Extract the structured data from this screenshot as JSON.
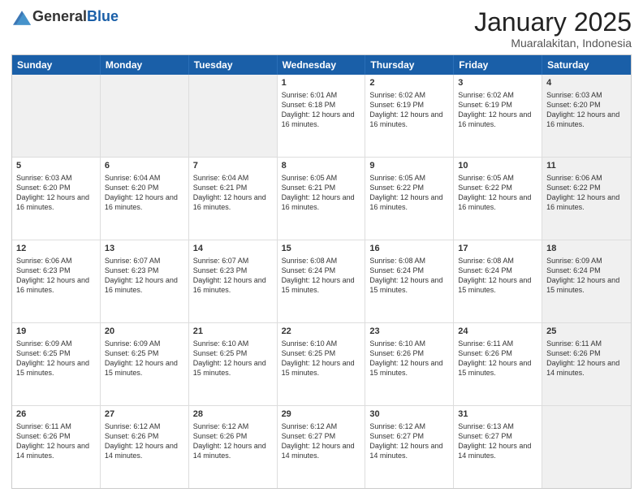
{
  "header": {
    "logo_general": "General",
    "logo_blue": "Blue",
    "month": "January 2025",
    "location": "Muaralakitan, Indonesia"
  },
  "days_of_week": [
    "Sunday",
    "Monday",
    "Tuesday",
    "Wednesday",
    "Thursday",
    "Friday",
    "Saturday"
  ],
  "weeks": [
    [
      {
        "day": "",
        "sunrise": "",
        "sunset": "",
        "daylight": "",
        "shaded": true
      },
      {
        "day": "",
        "sunrise": "",
        "sunset": "",
        "daylight": "",
        "shaded": true
      },
      {
        "day": "",
        "sunrise": "",
        "sunset": "",
        "daylight": "",
        "shaded": true
      },
      {
        "day": "1",
        "sunrise": "Sunrise: 6:01 AM",
        "sunset": "Sunset: 6:18 PM",
        "daylight": "Daylight: 12 hours and 16 minutes.",
        "shaded": false
      },
      {
        "day": "2",
        "sunrise": "Sunrise: 6:02 AM",
        "sunset": "Sunset: 6:19 PM",
        "daylight": "Daylight: 12 hours and 16 minutes.",
        "shaded": false
      },
      {
        "day": "3",
        "sunrise": "Sunrise: 6:02 AM",
        "sunset": "Sunset: 6:19 PM",
        "daylight": "Daylight: 12 hours and 16 minutes.",
        "shaded": false
      },
      {
        "day": "4",
        "sunrise": "Sunrise: 6:03 AM",
        "sunset": "Sunset: 6:20 PM",
        "daylight": "Daylight: 12 hours and 16 minutes.",
        "shaded": true
      }
    ],
    [
      {
        "day": "5",
        "sunrise": "Sunrise: 6:03 AM",
        "sunset": "Sunset: 6:20 PM",
        "daylight": "Daylight: 12 hours and 16 minutes.",
        "shaded": false
      },
      {
        "day": "6",
        "sunrise": "Sunrise: 6:04 AM",
        "sunset": "Sunset: 6:20 PM",
        "daylight": "Daylight: 12 hours and 16 minutes.",
        "shaded": false
      },
      {
        "day": "7",
        "sunrise": "Sunrise: 6:04 AM",
        "sunset": "Sunset: 6:21 PM",
        "daylight": "Daylight: 12 hours and 16 minutes.",
        "shaded": false
      },
      {
        "day": "8",
        "sunrise": "Sunrise: 6:05 AM",
        "sunset": "Sunset: 6:21 PM",
        "daylight": "Daylight: 12 hours and 16 minutes.",
        "shaded": false
      },
      {
        "day": "9",
        "sunrise": "Sunrise: 6:05 AM",
        "sunset": "Sunset: 6:22 PM",
        "daylight": "Daylight: 12 hours and 16 minutes.",
        "shaded": false
      },
      {
        "day": "10",
        "sunrise": "Sunrise: 6:05 AM",
        "sunset": "Sunset: 6:22 PM",
        "daylight": "Daylight: 12 hours and 16 minutes.",
        "shaded": false
      },
      {
        "day": "11",
        "sunrise": "Sunrise: 6:06 AM",
        "sunset": "Sunset: 6:22 PM",
        "daylight": "Daylight: 12 hours and 16 minutes.",
        "shaded": true
      }
    ],
    [
      {
        "day": "12",
        "sunrise": "Sunrise: 6:06 AM",
        "sunset": "Sunset: 6:23 PM",
        "daylight": "Daylight: 12 hours and 16 minutes.",
        "shaded": false
      },
      {
        "day": "13",
        "sunrise": "Sunrise: 6:07 AM",
        "sunset": "Sunset: 6:23 PM",
        "daylight": "Daylight: 12 hours and 16 minutes.",
        "shaded": false
      },
      {
        "day": "14",
        "sunrise": "Sunrise: 6:07 AM",
        "sunset": "Sunset: 6:23 PM",
        "daylight": "Daylight: 12 hours and 16 minutes.",
        "shaded": false
      },
      {
        "day": "15",
        "sunrise": "Sunrise: 6:08 AM",
        "sunset": "Sunset: 6:24 PM",
        "daylight": "Daylight: 12 hours and 15 minutes.",
        "shaded": false
      },
      {
        "day": "16",
        "sunrise": "Sunrise: 6:08 AM",
        "sunset": "Sunset: 6:24 PM",
        "daylight": "Daylight: 12 hours and 15 minutes.",
        "shaded": false
      },
      {
        "day": "17",
        "sunrise": "Sunrise: 6:08 AM",
        "sunset": "Sunset: 6:24 PM",
        "daylight": "Daylight: 12 hours and 15 minutes.",
        "shaded": false
      },
      {
        "day": "18",
        "sunrise": "Sunrise: 6:09 AM",
        "sunset": "Sunset: 6:24 PM",
        "daylight": "Daylight: 12 hours and 15 minutes.",
        "shaded": true
      }
    ],
    [
      {
        "day": "19",
        "sunrise": "Sunrise: 6:09 AM",
        "sunset": "Sunset: 6:25 PM",
        "daylight": "Daylight: 12 hours and 15 minutes.",
        "shaded": false
      },
      {
        "day": "20",
        "sunrise": "Sunrise: 6:09 AM",
        "sunset": "Sunset: 6:25 PM",
        "daylight": "Daylight: 12 hours and 15 minutes.",
        "shaded": false
      },
      {
        "day": "21",
        "sunrise": "Sunrise: 6:10 AM",
        "sunset": "Sunset: 6:25 PM",
        "daylight": "Daylight: 12 hours and 15 minutes.",
        "shaded": false
      },
      {
        "day": "22",
        "sunrise": "Sunrise: 6:10 AM",
        "sunset": "Sunset: 6:25 PM",
        "daylight": "Daylight: 12 hours and 15 minutes.",
        "shaded": false
      },
      {
        "day": "23",
        "sunrise": "Sunrise: 6:10 AM",
        "sunset": "Sunset: 6:26 PM",
        "daylight": "Daylight: 12 hours and 15 minutes.",
        "shaded": false
      },
      {
        "day": "24",
        "sunrise": "Sunrise: 6:11 AM",
        "sunset": "Sunset: 6:26 PM",
        "daylight": "Daylight: 12 hours and 15 minutes.",
        "shaded": false
      },
      {
        "day": "25",
        "sunrise": "Sunrise: 6:11 AM",
        "sunset": "Sunset: 6:26 PM",
        "daylight": "Daylight: 12 hours and 14 minutes.",
        "shaded": true
      }
    ],
    [
      {
        "day": "26",
        "sunrise": "Sunrise: 6:11 AM",
        "sunset": "Sunset: 6:26 PM",
        "daylight": "Daylight: 12 hours and 14 minutes.",
        "shaded": false
      },
      {
        "day": "27",
        "sunrise": "Sunrise: 6:12 AM",
        "sunset": "Sunset: 6:26 PM",
        "daylight": "Daylight: 12 hours and 14 minutes.",
        "shaded": false
      },
      {
        "day": "28",
        "sunrise": "Sunrise: 6:12 AM",
        "sunset": "Sunset: 6:26 PM",
        "daylight": "Daylight: 12 hours and 14 minutes.",
        "shaded": false
      },
      {
        "day": "29",
        "sunrise": "Sunrise: 6:12 AM",
        "sunset": "Sunset: 6:27 PM",
        "daylight": "Daylight: 12 hours and 14 minutes.",
        "shaded": false
      },
      {
        "day": "30",
        "sunrise": "Sunrise: 6:12 AM",
        "sunset": "Sunset: 6:27 PM",
        "daylight": "Daylight: 12 hours and 14 minutes.",
        "shaded": false
      },
      {
        "day": "31",
        "sunrise": "Sunrise: 6:13 AM",
        "sunset": "Sunset: 6:27 PM",
        "daylight": "Daylight: 12 hours and 14 minutes.",
        "shaded": false
      },
      {
        "day": "",
        "sunrise": "",
        "sunset": "",
        "daylight": "",
        "shaded": true
      }
    ]
  ]
}
